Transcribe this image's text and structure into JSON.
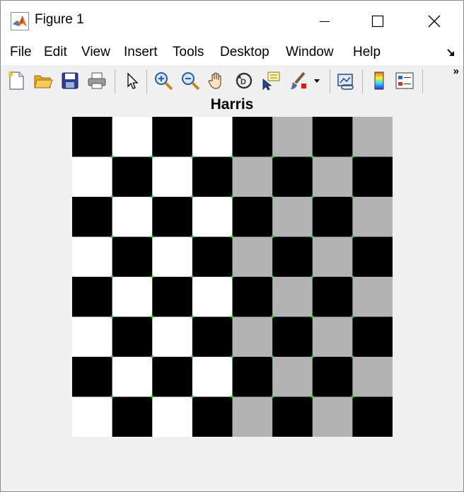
{
  "window": {
    "title": "Figure 1",
    "controls": [
      "minimize",
      "maximize",
      "close"
    ]
  },
  "menubar": {
    "items": [
      {
        "label": "File"
      },
      {
        "label": "Edit"
      },
      {
        "label": "View"
      },
      {
        "label": "Insert"
      },
      {
        "label": "Tools"
      },
      {
        "label": "Desktop"
      },
      {
        "label": "Window"
      },
      {
        "label": "Help"
      }
    ]
  },
  "toolbar": {
    "buttons": [
      "new-figure-icon",
      "open-file-icon",
      "save-icon",
      "print-icon",
      "edit-plot-icon",
      "zoom-in-icon",
      "zoom-out-icon",
      "pan-icon",
      "rotate-3d-icon",
      "data-cursor-icon",
      "brush-icon",
      "link-plot-icon",
      "colorbar-icon",
      "legend-icon"
    ],
    "overflow": "»"
  },
  "plot": {
    "title": "Harris",
    "grid": {
      "rows": 8,
      "cols": 8,
      "cells": [
        [
          0,
          1,
          0,
          1,
          0,
          2,
          0,
          2
        ],
        [
          1,
          0,
          1,
          0,
          2,
          0,
          2,
          0
        ],
        [
          0,
          1,
          0,
          1,
          0,
          2,
          0,
          2
        ],
        [
          1,
          0,
          1,
          0,
          2,
          0,
          2,
          0
        ],
        [
          0,
          1,
          0,
          1,
          0,
          2,
          0,
          2
        ],
        [
          1,
          0,
          1,
          0,
          2,
          0,
          2,
          0
        ],
        [
          0,
          1,
          0,
          1,
          0,
          2,
          0,
          2
        ],
        [
          1,
          0,
          1,
          0,
          2,
          0,
          2,
          0
        ]
      ],
      "palette": [
        "#000000",
        "#ffffff",
        "#b3b3b3"
      ]
    },
    "corner_marker_color": "#1fd21f"
  }
}
